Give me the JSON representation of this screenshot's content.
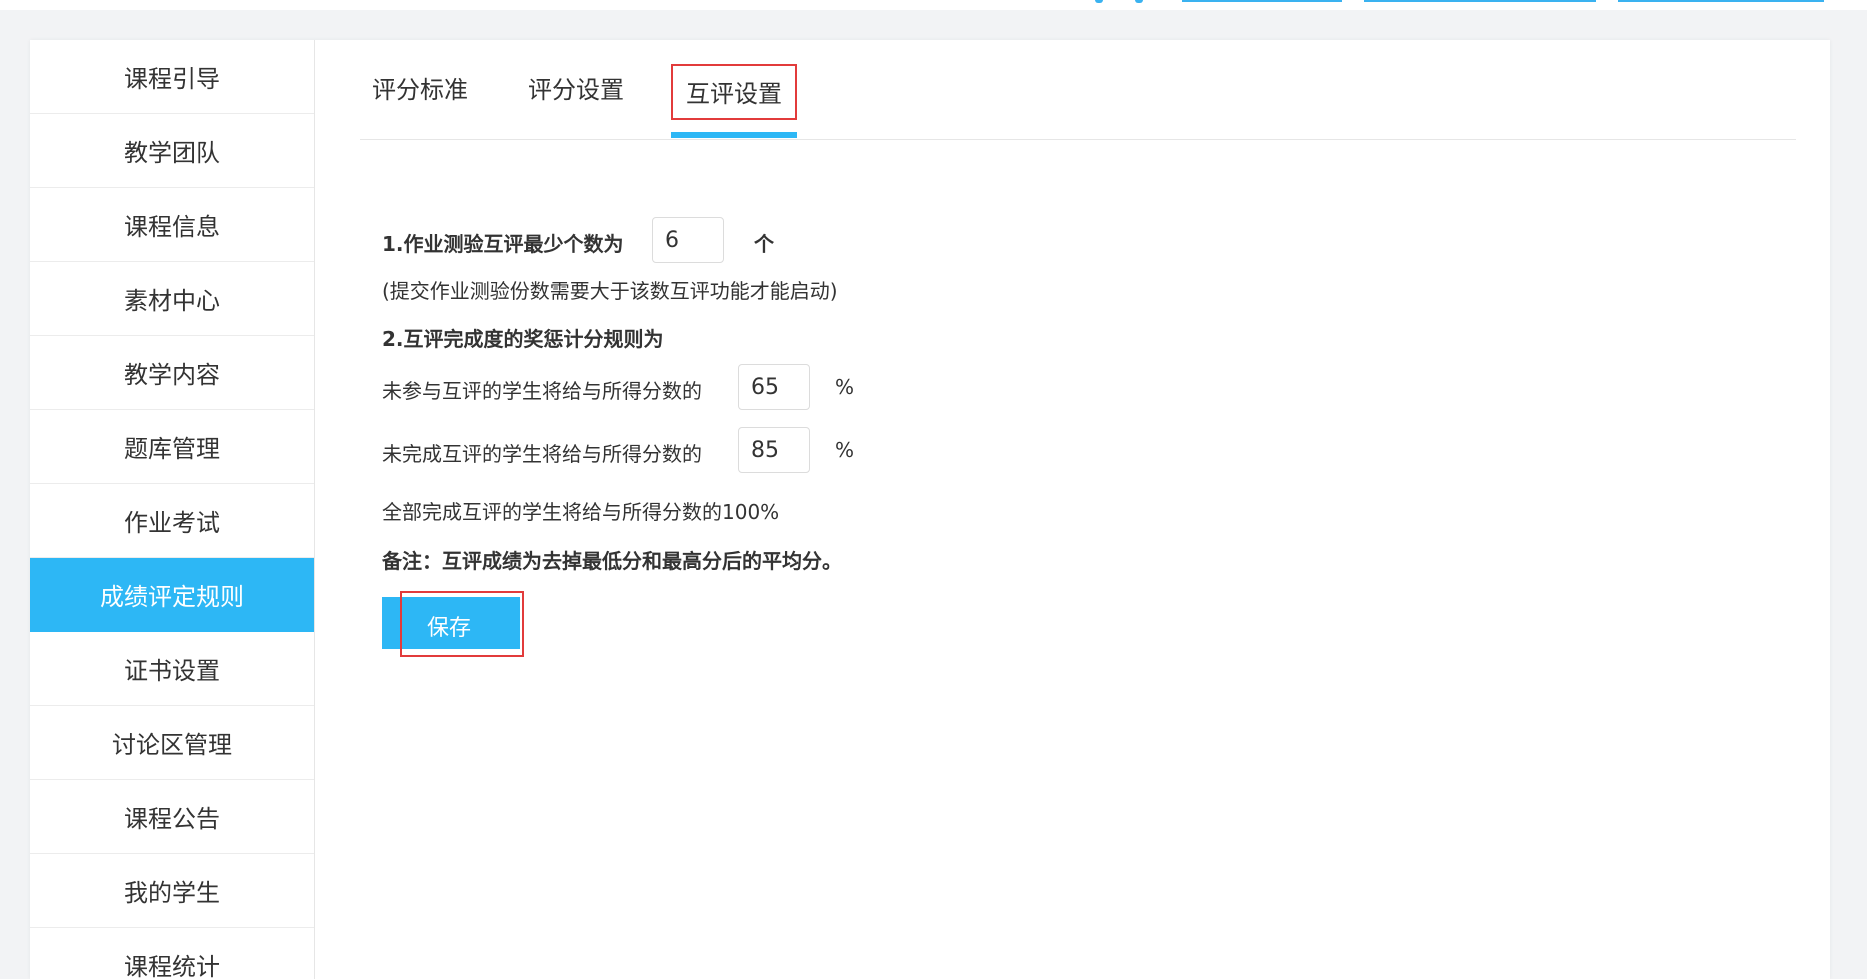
{
  "sidebar": {
    "items": [
      {
        "label": "课程引导"
      },
      {
        "label": "教学团队"
      },
      {
        "label": "课程信息"
      },
      {
        "label": "素材中心"
      },
      {
        "label": "教学内容"
      },
      {
        "label": "题库管理"
      },
      {
        "label": "作业考试"
      },
      {
        "label": "成绩评定规则",
        "active": true
      },
      {
        "label": "证书设置"
      },
      {
        "label": "讨论区管理"
      },
      {
        "label": "课程公告"
      },
      {
        "label": "我的学生"
      },
      {
        "label": "课程统计"
      }
    ]
  },
  "tabs": [
    {
      "label": "评分标准"
    },
    {
      "label": "评分设置"
    },
    {
      "label": "互评设置",
      "active": true
    }
  ],
  "peer_review": {
    "rule1_label": "1.作业测验互评最少个数为",
    "rule1_value": "6",
    "rule1_unit": "个",
    "rule1_hint": "(提交作业测验份数需要大于该数互评功能才能启动)",
    "rule2_title": "2.互评完成度的奖惩计分规则为",
    "not_participated_label": "未参与互评的学生将给与所得分数的",
    "not_participated_value": "65",
    "not_completed_label": "未完成互评的学生将给与所得分数的",
    "not_completed_value": "85",
    "percent_unit": "%",
    "all_completed_text": "全部完成互评的学生将给与所得分数的100%",
    "note": "备注：互评成绩为去掉最低分和最高分后的平均分。",
    "save_label": "保存"
  },
  "colors": {
    "accent": "#2db7f5",
    "highlight": "#e23b3b"
  }
}
